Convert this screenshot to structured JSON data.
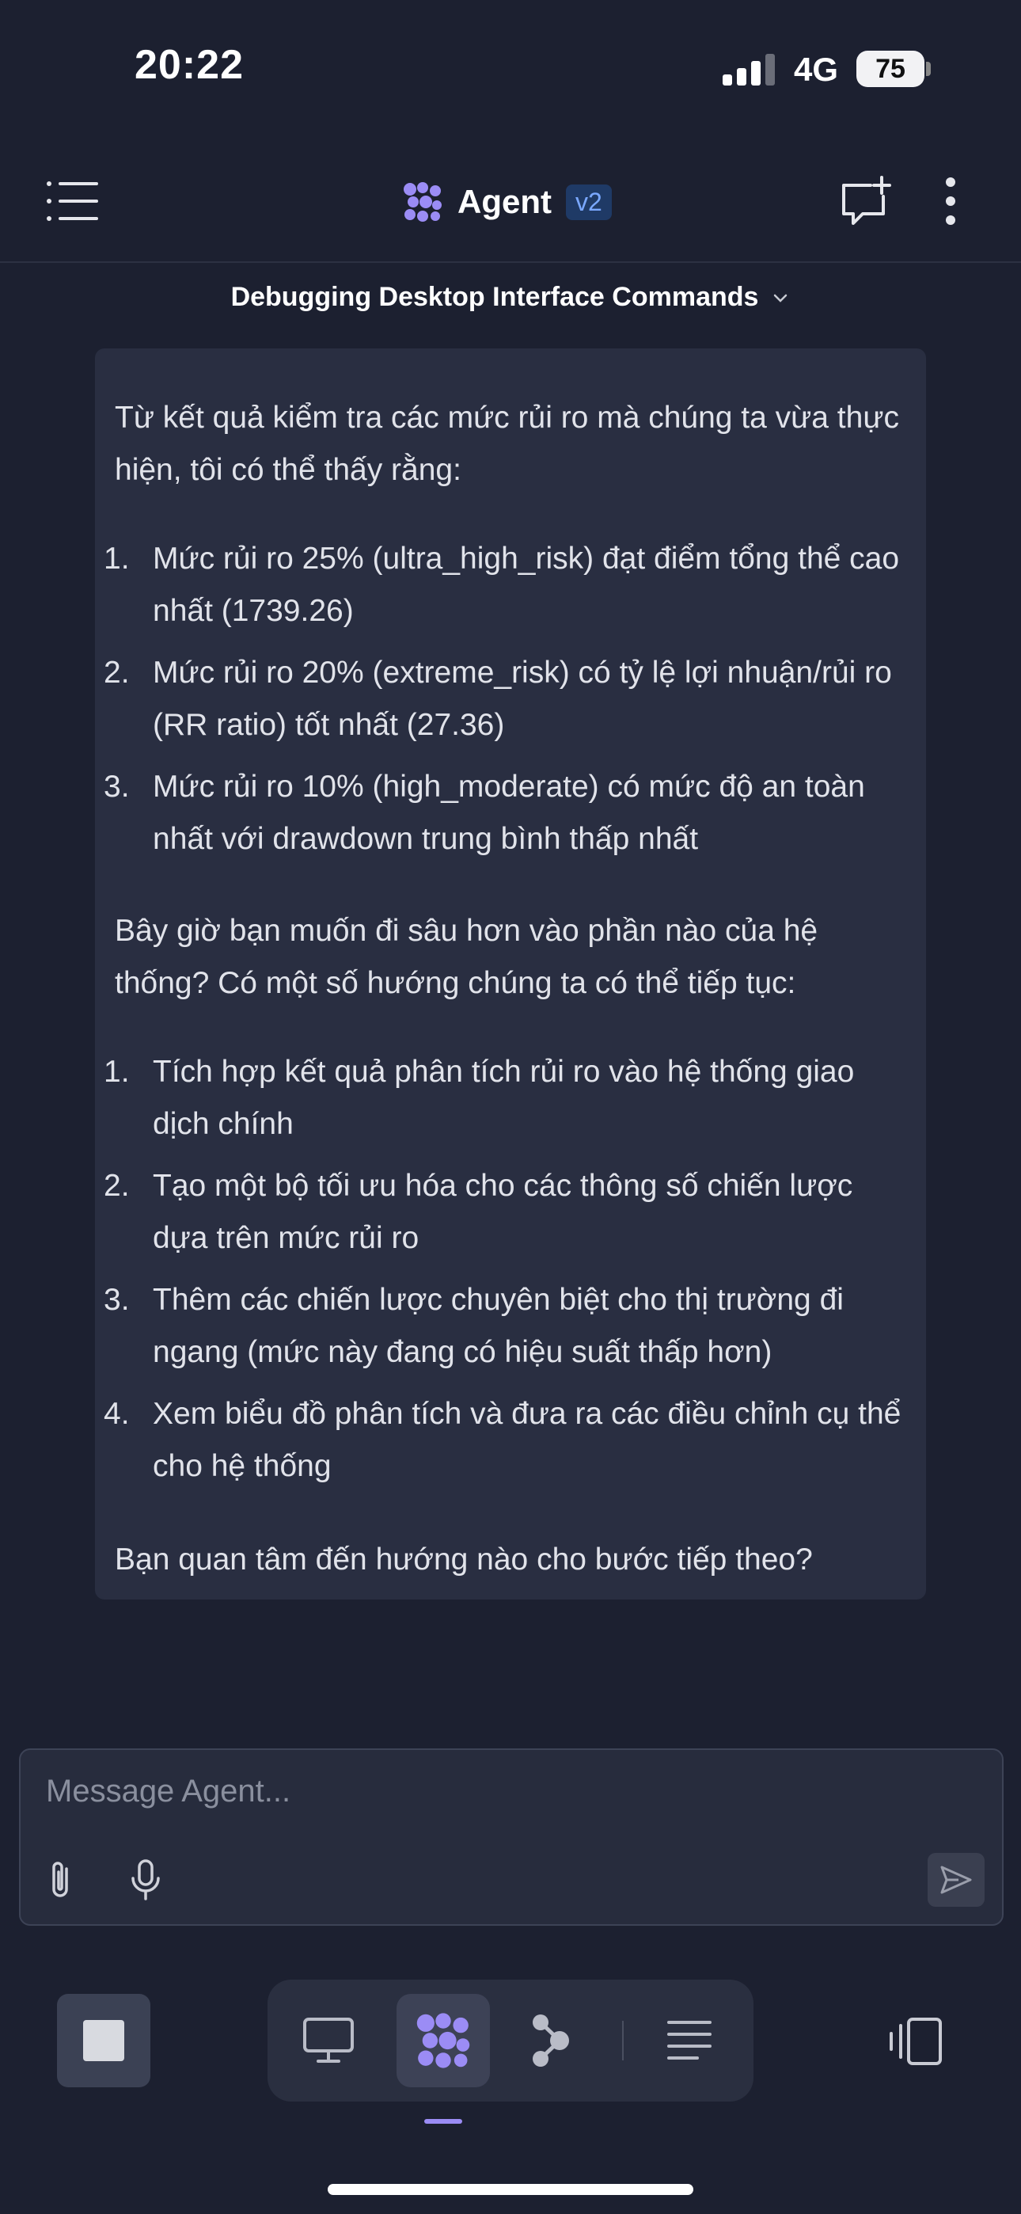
{
  "status_bar": {
    "time": "20:22",
    "network": "4G",
    "battery": "75"
  },
  "header": {
    "title": "Agent",
    "version": "v2",
    "conversation_title": "Debugging Desktop Interface Commands"
  },
  "message": {
    "intro": "Từ kết quả kiểm tra các mức rủi ro mà chúng ta vừa thực hiện, tôi có thể thấy rằng:",
    "findings": [
      {
        "num": "1.",
        "text": "Mức rủi ro 25% (ultra_high_risk) đạt điểm tổng thể cao nhất (1739.26)"
      },
      {
        "num": "2.",
        "text": "Mức rủi ro 20% (extreme_risk) có tỷ lệ lợi nhuận/rủi ro (RR ratio) tốt nhất (27.36)"
      },
      {
        "num": "3.",
        "text": "Mức rủi ro 10% (high_moderate) có mức độ an toàn nhất với drawdown trung bình thấp nhất"
      }
    ],
    "question": "Bây giờ bạn muốn đi sâu hơn vào phần nào của hệ thống? Có một số hướng chúng ta có thể tiếp tục:",
    "options": [
      {
        "num": "1.",
        "text": "Tích hợp kết quả phân tích rủi ro vào hệ thống giao dịch chính"
      },
      {
        "num": "2.",
        "text": "Tạo một bộ tối ưu hóa cho các thông số chiến lược dựa trên mức rủi ro"
      },
      {
        "num": "3.",
        "text": "Thêm các chiến lược chuyên biệt cho thị trường đi ngang (mức này đang có hiệu suất thấp hơn)"
      },
      {
        "num": "4.",
        "text": "Xem biểu đồ phân tích và đưa ra các điều chỉnh cụ thể cho hệ thống"
      }
    ],
    "closing": "Bạn quan tâm đến hướng nào cho bước tiếp theo?"
  },
  "composer": {
    "placeholder": "Message Agent..."
  },
  "colors": {
    "accent": "#9b8cf5",
    "background": "#1c2030",
    "card": "#292e41",
    "version_badge": "#1f3a66"
  }
}
